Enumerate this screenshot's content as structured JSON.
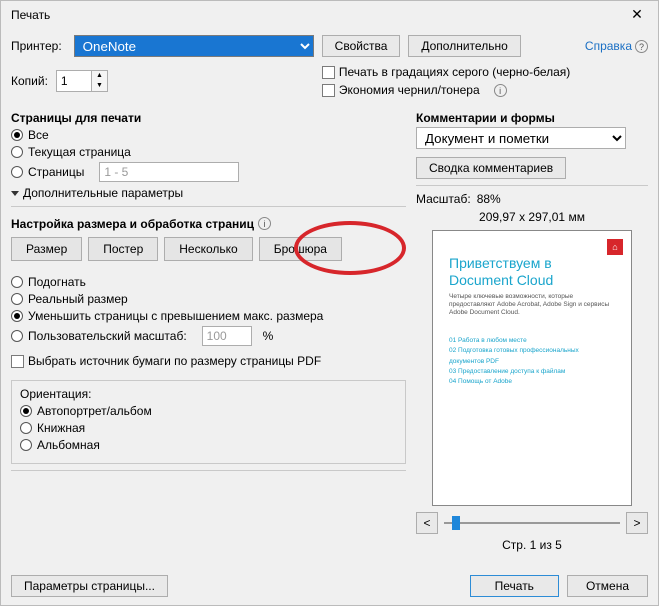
{
  "title": "Печать",
  "helpLink": "Справка",
  "printer": {
    "label": "Принтер:",
    "value": "OneNote"
  },
  "buttons": {
    "props": "Свойства",
    "advanced": "Дополнительно",
    "summary": "Сводка комментариев",
    "pageSetup": "Параметры страницы...",
    "print": "Печать",
    "cancel": "Отмена"
  },
  "copies": {
    "label": "Копий:",
    "value": "1"
  },
  "checks": {
    "grayscale": "Печать в градациях серого (черно-белая)",
    "saveInk": "Экономия чернил/тонера",
    "paperSource": "Выбрать источник бумаги по размеру страницы PDF"
  },
  "pagesGroup": {
    "title": "Страницы для печати",
    "all": "Все",
    "current": "Текущая страница",
    "pages": "Страницы",
    "pagesRange": "1 - 5",
    "more": "Дополнительные параметры"
  },
  "sizeGroup": {
    "title": "Настройка размера и обработка страниц",
    "tabs": {
      "size": "Размер",
      "poster": "Постер",
      "multi": "Несколько",
      "booklet": "Брошюра"
    },
    "fit": "Подогнать",
    "actual": "Реальный размер",
    "shrink": "Уменьшить страницы с превышением макс. размера",
    "custom": "Пользовательский масштаб:",
    "customVal": "100",
    "pct": "%"
  },
  "orientation": {
    "title": "Ориентация:",
    "auto": "Автопортрет/альбом",
    "portrait": "Книжная",
    "landscape": "Альбомная"
  },
  "comments": {
    "title": "Комментарии и формы",
    "value": "Документ и пометки"
  },
  "preview": {
    "scaleLabel": "Масштаб:",
    "scaleVal": "88%",
    "dims": "209,97 x 297,01 мм",
    "docTitle1": "Приветствуем в",
    "docTitle2": "Document Cloud",
    "docSub": "Четыре ключевые возможности, которые предоставляют Adobe Acrobat, Adobe Sign и сервисы Adobe Document Cloud.",
    "i1": "01  Работа в любом месте",
    "i2": "02  Подготовка готовых профессиональных документов PDF",
    "i3": "03  Предоставление доступа к файлам",
    "i4": "04  Помощь от Adobe",
    "page": "Стр. 1 из 5"
  }
}
